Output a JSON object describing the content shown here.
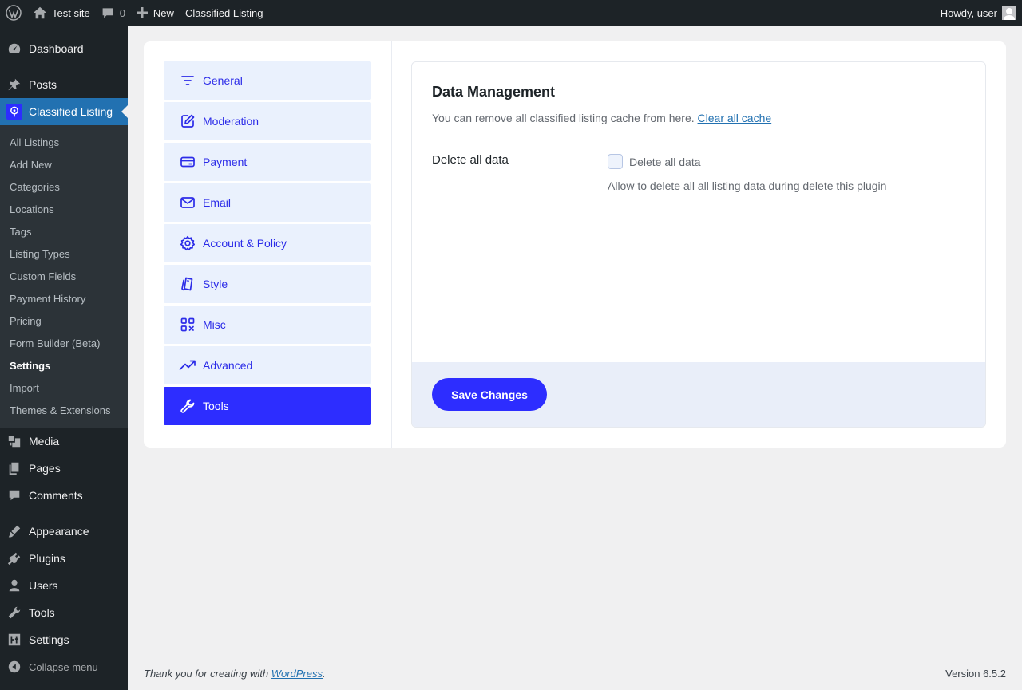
{
  "adminbar": {
    "site_name": "Test site",
    "comments_count": "0",
    "new_label": "New",
    "classified_label": "Classified Listing",
    "howdy": "Howdy, user"
  },
  "sidebar": {
    "dashboard": "Dashboard",
    "posts": "Posts",
    "classified": "Classified Listing",
    "submenu": [
      "All Listings",
      "Add New",
      "Categories",
      "Locations",
      "Tags",
      "Listing Types",
      "Custom Fields",
      "Payment History",
      "Pricing",
      "Form Builder (Beta)",
      "Settings",
      "Import",
      "Themes & Extensions"
    ],
    "media": "Media",
    "pages": "Pages",
    "comments": "Comments",
    "appearance": "Appearance",
    "plugins": "Plugins",
    "users": "Users",
    "tools": "Tools",
    "settings": "Settings",
    "collapse": "Collapse menu"
  },
  "tabs": [
    {
      "label": "General",
      "icon": "filter-icon"
    },
    {
      "label": "Moderation",
      "icon": "edit-icon"
    },
    {
      "label": "Payment",
      "icon": "credit-card-icon"
    },
    {
      "label": "Email",
      "icon": "mail-icon"
    },
    {
      "label": "Account & Policy",
      "icon": "gear-icon"
    },
    {
      "label": "Style",
      "icon": "style-icon"
    },
    {
      "label": "Misc",
      "icon": "grid-icon"
    },
    {
      "label": "Advanced",
      "icon": "trend-icon"
    },
    {
      "label": "Tools",
      "icon": "wrench-icon"
    }
  ],
  "active_tab": "Tools",
  "section": {
    "title": "Data Management",
    "desc": "You can remove all classified listing cache from here.",
    "clear_link": "Clear all cache",
    "row_label": "Delete all data",
    "checkbox_label": "Delete all data",
    "checkbox_checked": false,
    "help": "Allow to delete all all listing data during delete this plugin",
    "save": "Save Changes"
  },
  "footer": {
    "thanks": "Thank you for creating with",
    "wp_link": "WordPress",
    "period": ".",
    "version": "Version 6.5.2"
  }
}
